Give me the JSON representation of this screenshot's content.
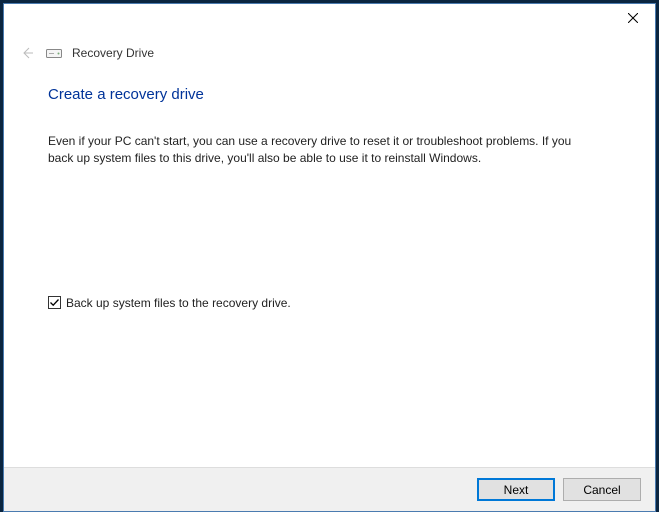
{
  "titlebar": {
    "close_tooltip": "Close"
  },
  "header": {
    "window_title": "Recovery Drive"
  },
  "main": {
    "heading": "Create a recovery drive",
    "description": "Even if your PC can't start, you can use a recovery drive to reset it or troubleshoot problems. If you back up system files to this drive, you'll also be able to use it to reinstall Windows."
  },
  "options": {
    "backup_checkbox_label": "Back up system files to the recovery drive.",
    "backup_checked": true
  },
  "footer": {
    "next_label": "Next",
    "cancel_label": "Cancel"
  }
}
